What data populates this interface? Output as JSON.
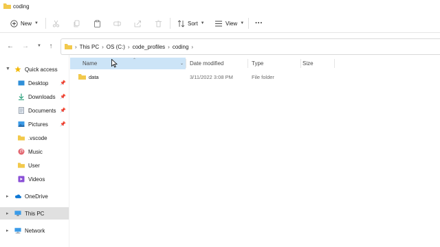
{
  "window": {
    "title": "coding"
  },
  "toolbar": {
    "new_label": "New",
    "sort_label": "Sort",
    "view_label": "View",
    "more_label": "···"
  },
  "nav": {
    "breadcrumb": [
      "This PC",
      "OS (C:)",
      "code_profiles",
      "coding"
    ]
  },
  "sidebar": {
    "quick_access": "Quick access",
    "items": [
      {
        "label": "Desktop",
        "icon": "desktop-icon",
        "pinned": true
      },
      {
        "label": "Downloads",
        "icon": "download-icon",
        "pinned": true
      },
      {
        "label": "Documents",
        "icon": "documents-icon",
        "pinned": true
      },
      {
        "label": "Pictures",
        "icon": "pictures-icon",
        "pinned": true
      },
      {
        "label": ".vscode",
        "icon": "folder-icon",
        "pinned": false
      },
      {
        "label": "Music",
        "icon": "music-icon",
        "pinned": false
      },
      {
        "label": "User",
        "icon": "folder-icon",
        "pinned": false
      },
      {
        "label": "Videos",
        "icon": "videos-icon",
        "pinned": false
      }
    ],
    "onedrive": "OneDrive",
    "this_pc": "This PC",
    "network": "Network"
  },
  "columns": {
    "name": "Name",
    "date_modified": "Date modified",
    "type": "Type",
    "size": "Size"
  },
  "files": [
    {
      "name": "data",
      "date_modified": "3/11/2022 3:08 PM",
      "type": "File folder",
      "size": ""
    }
  ],
  "colors": {
    "folder": "#f2c94c",
    "selected_header": "#cce4f7",
    "selected_nav": "#e0e0e0"
  }
}
